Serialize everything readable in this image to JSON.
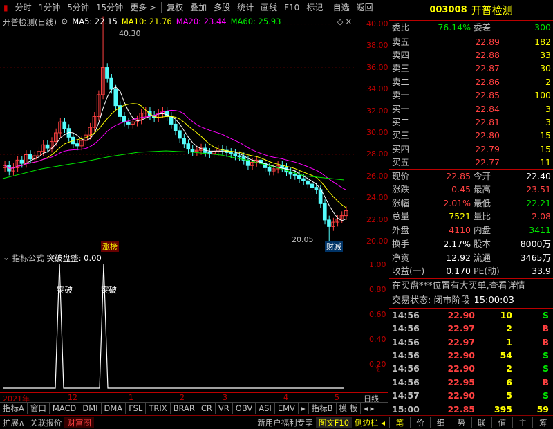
{
  "toolbar": {
    "items": [
      "分时",
      "1分钟",
      "5分钟",
      "15分钟",
      "更多 >",
      "复权",
      "叠加",
      "多股",
      "统计",
      "画线",
      "F10",
      "标记",
      "-自选",
      "返回"
    ]
  },
  "kline": {
    "title": "开普检测(日线)",
    "ma": [
      {
        "label": "MA5: 22.15",
        "color": "#ffffff"
      },
      {
        "label": "MA10: 21.76",
        "color": "#ffff00"
      },
      {
        "label": "MA20: 23.44",
        "color": "#ff00ff"
      },
      {
        "label": "MA60: 25.93",
        "color": "#00e600"
      }
    ],
    "high_label": "40.30",
    "low_label": "20.05",
    "tag_left": "涨榜",
    "tag_right": "财减",
    "yticks": [
      "40.00",
      "38.00",
      "36.00",
      "34.00",
      "32.00",
      "30.00",
      "28.00",
      "26.00",
      "24.00",
      "22.00",
      "20.00"
    ]
  },
  "indicator": {
    "formula_label": "指标公式",
    "name_label": "突破盘整: 0.00",
    "signal_labels": [
      "突破",
      "突破"
    ],
    "yticks": [
      "1.00",
      "0.80",
      "0.60",
      "0.40",
      "0.20"
    ],
    "collapse_label": "《"
  },
  "date_axis": {
    "labels": [
      "2021年",
      "12",
      "1",
      "2",
      "3",
      "4",
      "5"
    ],
    "period_label": "日线"
  },
  "tabs": [
    "指标A",
    "窗口",
    "MACD",
    "DMI",
    "DMA",
    "FSL",
    "TRIX",
    "BRAR",
    "CR",
    "VR",
    "OBV",
    "ASI",
    "EMV",
    "▸",
    "指标B",
    "模 板",
    "◂ ▸"
  ],
  "bottom": {
    "left": [
      "扩展∧",
      "关联报价",
      "财富圈"
    ],
    "center": [
      "新用户福利专享",
      "图文F10",
      "侧边栏 ◂"
    ],
    "right": [
      "笔",
      "价",
      "细",
      "势",
      "联",
      "值",
      "主",
      "筹"
    ]
  },
  "stock": {
    "code": "003008",
    "name": "开普检测"
  },
  "weibi": {
    "label": "委比",
    "value": "-76.14%",
    "label2": "委差",
    "value2": "-300"
  },
  "asks": [
    {
      "label": "卖五",
      "price": "22.89",
      "vol": "182"
    },
    {
      "label": "卖四",
      "price": "22.88",
      "vol": "33"
    },
    {
      "label": "卖三",
      "price": "22.87",
      "vol": "30"
    },
    {
      "label": "卖二",
      "price": "22.86",
      "vol": "2"
    },
    {
      "label": "卖一",
      "price": "22.85",
      "vol": "100"
    }
  ],
  "bids": [
    {
      "label": "买一",
      "price": "22.84",
      "vol": "3"
    },
    {
      "label": "买二",
      "price": "22.81",
      "vol": "3"
    },
    {
      "label": "买三",
      "price": "22.80",
      "vol": "15"
    },
    {
      "label": "买四",
      "price": "22.79",
      "vol": "15"
    },
    {
      "label": "买五",
      "price": "22.77",
      "vol": "11"
    }
  ],
  "quote": [
    {
      "a": "现价",
      "b": "22.85",
      "bc": "red",
      "c": "今开",
      "d": "22.40",
      "dc": "white"
    },
    {
      "a": "涨跌",
      "b": "0.45",
      "bc": "red",
      "c": "最高",
      "d": "23.51",
      "dc": "red"
    },
    {
      "a": "涨幅",
      "b": "2.01%",
      "bc": "red",
      "c": "最低",
      "d": "22.21",
      "dc": "green"
    },
    {
      "a": "总量",
      "b": "7521",
      "bc": "yellow",
      "c": "量比",
      "d": "2.08",
      "dc": "red"
    },
    {
      "a": "外盘",
      "b": "4110",
      "bc": "red",
      "c": "内盘",
      "d": "3411",
      "dc": "green"
    }
  ],
  "finance": [
    {
      "a": "换手",
      "b": "2.17%",
      "c": "股本",
      "d": "8000万"
    },
    {
      "a": "净资",
      "b": "12.92",
      "c": "流通",
      "d": "3465万"
    },
    {
      "a": "收益(一)",
      "b": "0.170",
      "c": "PE(动)",
      "d": "33.9"
    }
  ],
  "notice": "在买盘***位置有大买单,查看详情",
  "trade_status": {
    "label": "交易状态: 闭市阶段",
    "time": "15:00:03"
  },
  "ticks": [
    {
      "t": "14:56",
      "p": "22.90",
      "v": "10",
      "s": "S",
      "sc": "green"
    },
    {
      "t": "14:56",
      "p": "22.97",
      "v": "2",
      "s": "B",
      "sc": "red"
    },
    {
      "t": "14:56",
      "p": "22.97",
      "v": "1",
      "s": "B",
      "sc": "red"
    },
    {
      "t": "14:56",
      "p": "22.90",
      "v": "54",
      "s": "S",
      "sc": "green"
    },
    {
      "t": "14:56",
      "p": "22.90",
      "v": "2",
      "s": "S",
      "sc": "green"
    },
    {
      "t": "14:56",
      "p": "22.95",
      "v": "6",
      "s": "B",
      "sc": "red"
    },
    {
      "t": "14:57",
      "p": "22.90",
      "v": "5",
      "s": "S",
      "sc": "green"
    },
    {
      "t": "15:00",
      "p": "22.85",
      "v": "395",
      "s": "59",
      "sc": "yellow"
    }
  ]
}
